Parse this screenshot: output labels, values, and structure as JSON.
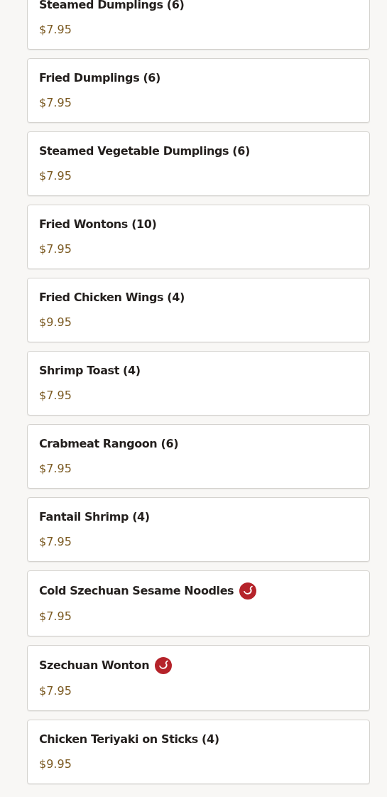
{
  "menu_items": [
    {
      "name": "Steamed Dumplings (6)",
      "price": "$7.95",
      "spicy": false
    },
    {
      "name": "Fried Dumplings (6)",
      "price": "$7.95",
      "spicy": false
    },
    {
      "name": "Steamed Vegetable Dumplings (6)",
      "price": "$7.95",
      "spicy": false
    },
    {
      "name": "Fried Wontons (10)",
      "price": "$7.95",
      "spicy": false
    },
    {
      "name": "Fried Chicken Wings (4)",
      "price": "$9.95",
      "spicy": false
    },
    {
      "name": "Shrimp Toast (4)",
      "price": "$7.95",
      "spicy": false
    },
    {
      "name": "Crabmeat Rangoon (6)",
      "price": "$7.95",
      "spicy": false
    },
    {
      "name": "Fantail Shrimp (4)",
      "price": "$7.95",
      "spicy": false
    },
    {
      "name": "Cold Szechuan Sesame Noodles",
      "price": "$7.95",
      "spicy": true
    },
    {
      "name": "Szechuan Wonton",
      "price": "$7.95",
      "spicy": true
    },
    {
      "name": "Chicken Teriyaki on Sticks (4)",
      "price": "$9.95",
      "spicy": false
    }
  ]
}
